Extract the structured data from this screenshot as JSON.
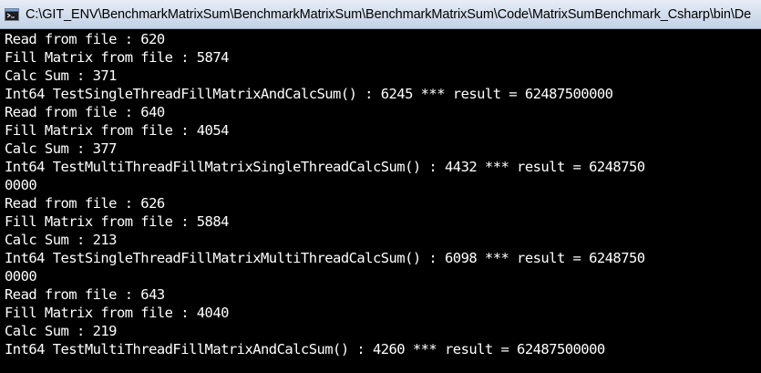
{
  "window": {
    "title": "C:\\GIT_ENV\\BenchmarkMatrixSum\\BenchmarkMatrixSum\\BenchmarkMatrixSum\\Code\\MatrixSumBenchmark_Csharp\\bin\\De",
    "icon": "console-app-icon",
    "colors": {
      "background": "#000000",
      "text": "#ffffff"
    }
  },
  "console": {
    "lines": [
      "Read from file : 620",
      "Fill Matrix from file : 5874",
      "Calc Sum : 371",
      "Int64 TestSingleThreadFillMatrixAndCalcSum() : 6245 *** result = 62487500000",
      "Read from file : 640",
      "Fill Matrix from file : 4054",
      "Calc Sum : 377",
      "Int64 TestMultiThreadFillMatrixSingleThreadCalcSum() : 4432 *** result = 6248750",
      "0000",
      "Read from file : 626",
      "Fill Matrix from file : 5884",
      "Calc Sum : 213",
      "Int64 TestSingleThreadFillMatrixMultiThreadCalcSum() : 6098 *** result = 6248750",
      "0000",
      "Read from file : 643",
      "Fill Matrix from file : 4040",
      "Calc Sum : 219",
      "Int64 TestMultiThreadFillMatrixAndCalcSum() : 4260 *** result = 62487500000"
    ]
  }
}
